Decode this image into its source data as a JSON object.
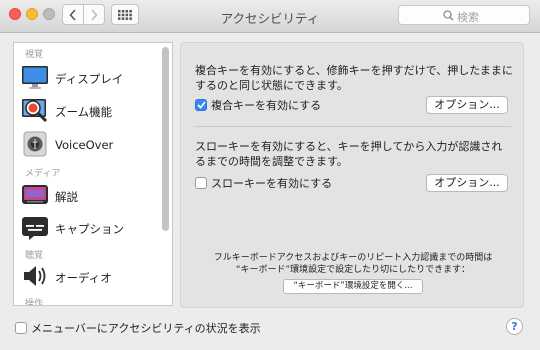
{
  "window": {
    "title": "アクセシビリティ"
  },
  "toolbar": {
    "search_placeholder": "検索"
  },
  "sidebar": {
    "sections": [
      "視覚",
      "メディア",
      "聴覚",
      "操作"
    ],
    "items": [
      {
        "label": "ディスプレイ",
        "icon": "display-icon"
      },
      {
        "label": "ズーム機能",
        "icon": "zoom-icon"
      },
      {
        "label": "VoiceOver",
        "icon": "voiceover-icon"
      },
      {
        "label": "解説",
        "icon": "descriptions-icon"
      },
      {
        "label": "キャプション",
        "icon": "captions-icon"
      },
      {
        "label": "オーディオ",
        "icon": "audio-icon"
      }
    ]
  },
  "sticky_keys": {
    "description": "複合キーを有効にすると、修飾キーを押すだけで、押したままにするのと同じ状態にできます。",
    "checkbox_label": "複合キーを有効にする",
    "checked": true,
    "options_label": "オプション..."
  },
  "slow_keys": {
    "description": "スローキーを有効にすると、キーを押してから入力が認識されるまでの時間を調整できます。",
    "checkbox_label": "スローキーを有効にする",
    "checked": false,
    "options_label": "オプション..."
  },
  "keyboard_note": {
    "line1": "フルキーボードアクセスおよびキーのリピート入力認識までの時間は",
    "line2": "“キーボード”環境設定で設定したり切にしたりできます：",
    "button_label": "“キーボード”環境設定を開く..."
  },
  "footer": {
    "menubar_checkbox_label": "メニューバーにアクセシビリティの状況を表示",
    "menubar_checked": false,
    "help_label": "?"
  },
  "colors": {
    "accent": "#3a86f6",
    "close": "#fc5f57",
    "minimize": "#fdbc2e"
  }
}
